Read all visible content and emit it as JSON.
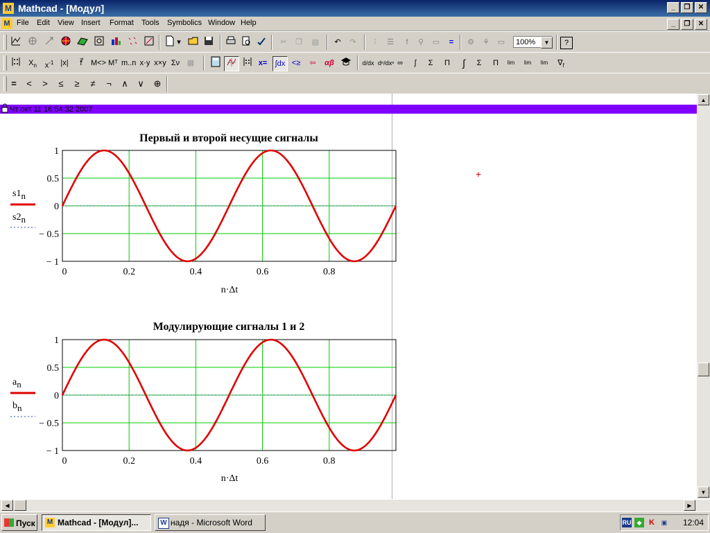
{
  "window": {
    "title": "Mathcad - [Модул]",
    "app_icon": "M"
  },
  "menu": [
    "File",
    "Edit",
    "View",
    "Insert",
    "Format",
    "Tools",
    "Symbolics",
    "Window",
    "Help"
  ],
  "toolbar": {
    "zoom": "100%"
  },
  "math_toolbar": {
    "x_sub": "X",
    "sub_n": "n",
    "x_inv": "x",
    "inv_exp": "-1",
    "abs": "|x|",
    "sigma_v": "Σν",
    "eq_x": "x=",
    "alpha_beta": "αβ",
    "infinity": "∞",
    "integral": "∫",
    "sum": "Σ",
    "prod": "Π",
    "lim": "lim",
    "nabla": "∇",
    "vf": "f"
  },
  "boolean_toolbar": [
    "=",
    "<",
    ">",
    "≤",
    "≥",
    "≠",
    "¬",
    "∧",
    "∨",
    "⊕"
  ],
  "document": {
    "header_timestamp": "Чт окт 11 16:54:32 2007",
    "cursor_glyph": "+"
  },
  "colors": {
    "series1": "#e00000",
    "series2": "#2a4fa8",
    "grid": "#00cc00",
    "header_bar": "#8000ff"
  },
  "chart_data": [
    {
      "type": "line",
      "title": "Первый и второй несущие сигналы",
      "xlabel": "n·Δt",
      "legend": [
        {
          "base": "s1",
          "sub": "n",
          "style": "solid",
          "color": "#e00000"
        },
        {
          "base": "s2",
          "sub": "n",
          "style": "dotted",
          "color": "#2a4fa8"
        }
      ],
      "xlim": [
        0,
        1
      ],
      "ylim": [
        -1,
        1
      ],
      "xticks": [
        0,
        0.2,
        0.4,
        0.6,
        0.8
      ],
      "xticklabels": [
        "0",
        "0.2",
        "0.4",
        "0.6",
        "0.8"
      ],
      "yticks": [
        1,
        0.5,
        0,
        -0.5,
        -1
      ],
      "yticklabels": [
        "1",
        "0.5",
        "0",
        "− 0.5",
        "− 1"
      ],
      "grid": true,
      "series": [
        {
          "formula": "sin(4πx)",
          "x": [
            0,
            0.125,
            0.25,
            0.375,
            0.5,
            0.625,
            0.75,
            0.875,
            1.0
          ],
          "y": [
            0,
            1,
            0,
            -1,
            0,
            1,
            0,
            -1,
            0
          ]
        },
        {
          "formula": "0",
          "x": [
            0,
            1
          ],
          "y": [
            0,
            0
          ]
        }
      ]
    },
    {
      "type": "line",
      "title": "Модулирующие сигналы 1 и 2",
      "xlabel": "n·Δt",
      "legend": [
        {
          "base": "a",
          "sub": "n",
          "style": "solid",
          "color": "#e00000"
        },
        {
          "base": "b",
          "sub": "n",
          "style": "dotted",
          "color": "#2a4fa8"
        }
      ],
      "xlim": [
        0,
        1
      ],
      "ylim": [
        -1,
        1
      ],
      "xticks": [
        0,
        0.2,
        0.4,
        0.6,
        0.8
      ],
      "xticklabels": [
        "0",
        "0.2",
        "0.4",
        "0.6",
        "0.8"
      ],
      "yticks": [
        1,
        0.5,
        0,
        -0.5,
        -1
      ],
      "yticklabels": [
        "1",
        "0.5",
        "0",
        "− 0.5",
        "− 1"
      ],
      "grid": true,
      "series": [
        {
          "formula": "sin(4πx)",
          "x": [
            0,
            0.125,
            0.25,
            0.375,
            0.5,
            0.625,
            0.75,
            0.875,
            1.0
          ],
          "y": [
            0,
            1,
            0,
            -1,
            0,
            1,
            0,
            -1,
            0
          ]
        },
        {
          "formula": "0",
          "x": [
            0,
            1
          ],
          "y": [
            0,
            0
          ]
        }
      ]
    }
  ],
  "taskbar": {
    "start": "Пуск",
    "tasks": [
      "Mathcad - [Модул]...",
      "надя - Microsoft Word"
    ],
    "clock": "12:04",
    "lang": "RU"
  }
}
